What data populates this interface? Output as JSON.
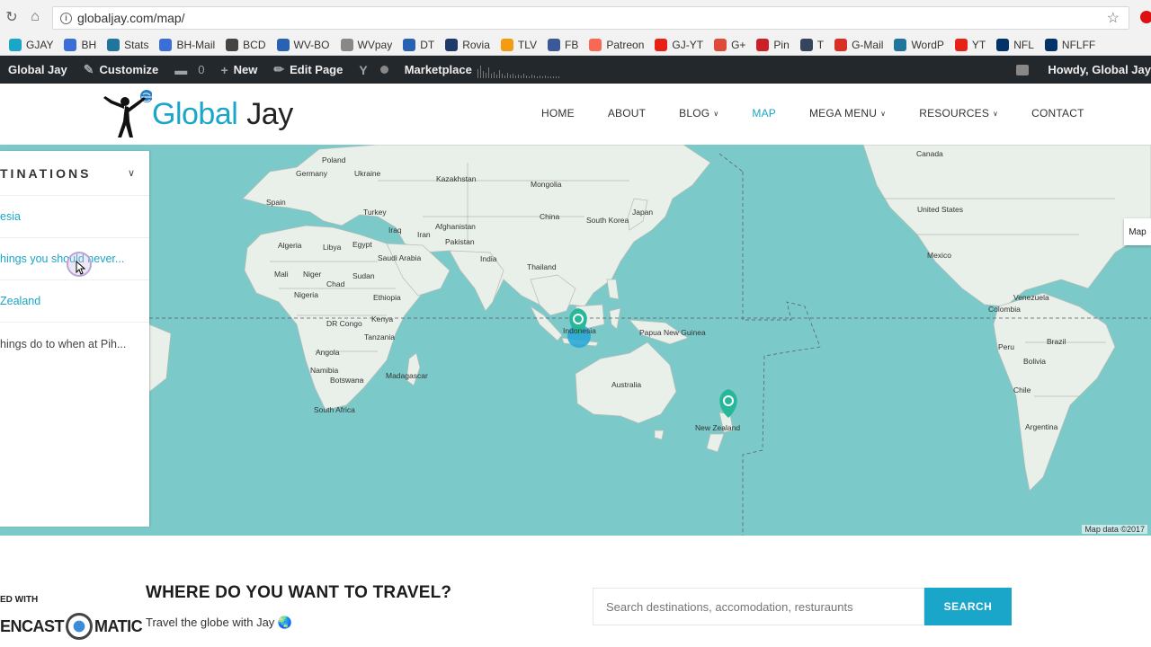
{
  "browser": {
    "url": "globaljay.com/map/",
    "bookmarks": [
      {
        "label": "GJAY",
        "color": "#1aa6c8"
      },
      {
        "label": "BH",
        "color": "#3b6ed6"
      },
      {
        "label": "Stats",
        "color": "#21759b"
      },
      {
        "label": "BH-Mail",
        "color": "#3b6ed6"
      },
      {
        "label": "BCD",
        "color": "#444444"
      },
      {
        "label": "WV-BO",
        "color": "#2a62b3"
      },
      {
        "label": "WVpay",
        "color": "#888888"
      },
      {
        "label": "DT",
        "color": "#2a62b3"
      },
      {
        "label": "Rovia",
        "color": "#1d3a6b"
      },
      {
        "label": "TLV",
        "color": "#f39c12"
      },
      {
        "label": "FB",
        "color": "#3b5998"
      },
      {
        "label": "Patreon",
        "color": "#f96854"
      },
      {
        "label": "GJ-YT",
        "color": "#e62117"
      },
      {
        "label": "G+",
        "color": "#dd4b39"
      },
      {
        "label": "Pin",
        "color": "#cb2027"
      },
      {
        "label": "T",
        "color": "#35465c"
      },
      {
        "label": "G-Mail",
        "color": "#d93025"
      },
      {
        "label": "WordP",
        "color": "#21759b"
      },
      {
        "label": "YT",
        "color": "#e62117"
      },
      {
        "label": "NFL",
        "color": "#013369"
      },
      {
        "label": "NFLFF",
        "color": "#013369"
      }
    ]
  },
  "adminbar": {
    "site": "Global Jay",
    "customize": "Customize",
    "comments": "0",
    "new": "New",
    "edit_page": "Edit Page",
    "marketplace": "Marketplace",
    "howdy": "Howdy, Global Jay"
  },
  "header": {
    "logo_part1": "Global",
    "logo_part2": "Jay",
    "nav": [
      {
        "label": "HOME",
        "dropdown": false,
        "active": false
      },
      {
        "label": "ABOUT",
        "dropdown": false,
        "active": false
      },
      {
        "label": "BLOG",
        "dropdown": true,
        "active": false
      },
      {
        "label": "MAP",
        "dropdown": false,
        "active": true
      },
      {
        "label": "MEGA MENU",
        "dropdown": true,
        "active": false
      },
      {
        "label": "RESOURCES",
        "dropdown": true,
        "active": false
      },
      {
        "label": "CONTACT",
        "dropdown": false,
        "active": false
      }
    ]
  },
  "sidepanel": {
    "title": "TINATIONS",
    "items": [
      {
        "label": "esia",
        "link": true
      },
      {
        "label": "hings you should never...",
        "link": true
      },
      {
        "label": "Zealand",
        "link": true
      },
      {
        "label": "hings do to when at Pih...",
        "link": false
      }
    ]
  },
  "map": {
    "map_button": "Map",
    "attribution": "Map data ©2017",
    "labels": [
      "Poland",
      "Germany",
      "Ukraine",
      "Kazakhstan",
      "Mongolia",
      "Spain",
      "Turkey",
      "China",
      "South Korea",
      "Japan",
      "Iraq",
      "Iran",
      "Afghanistan",
      "Pakistan",
      "Algeria",
      "Libya",
      "Egypt",
      "Saudi Arabia",
      "India",
      "Thailand",
      "Mali",
      "Niger",
      "Sudan",
      "Chad",
      "Nigeria",
      "Ethiopia",
      "Kenya",
      "DR Congo",
      "Tanzania",
      "Angola",
      "Namibia",
      "Botswana",
      "Madagascar",
      "South Africa",
      "Indonesia",
      "Papua New Guinea",
      "Australia",
      "New Zealand",
      "Canada",
      "United States",
      "Mexico",
      "Venezuela",
      "Colombia",
      "Peru",
      "Brazil",
      "Bolivia",
      "Chile",
      "Argentina"
    ],
    "markers": [
      {
        "name": "Indonesia marker",
        "color": "#27b89a"
      },
      {
        "name": "New Zealand marker",
        "color": "#27b89a"
      }
    ]
  },
  "travel": {
    "title": "WHERE DO YOU WANT TO TRAVEL?",
    "subtitle": "Travel the globe with Jay 🌏",
    "search_placeholder": "Search destinations, accomodation, resturaunts",
    "search_button": "SEARCH"
  },
  "watermark": {
    "top": "ED WITH",
    "left": "ENCAST",
    "right": "MATIC"
  }
}
